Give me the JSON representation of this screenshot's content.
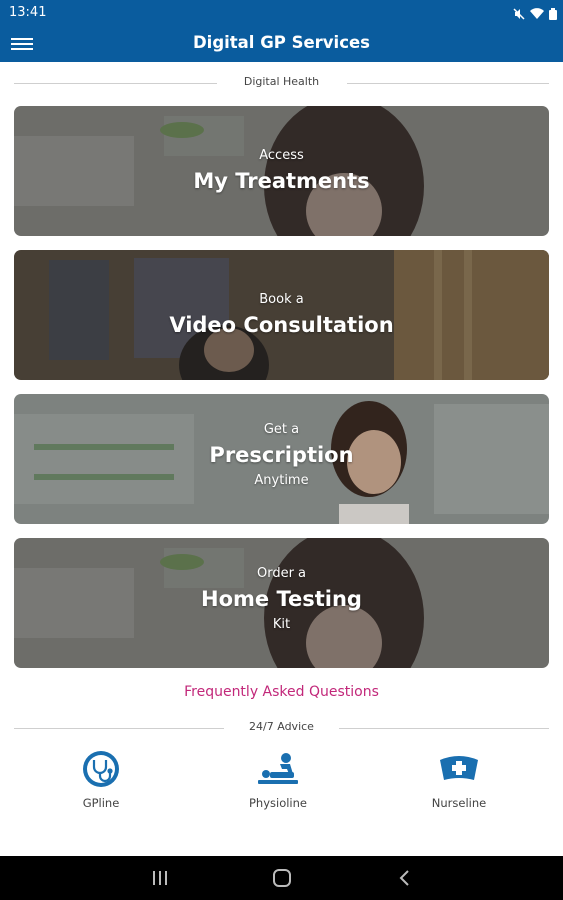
{
  "status_bar": {
    "time": "13:41"
  },
  "app_bar": {
    "title": "Digital GP Services"
  },
  "sections": {
    "digital_health": "Digital Health",
    "advice": "24/7 Advice"
  },
  "cards": [
    {
      "prefix": "Access",
      "title": "My Treatments",
      "suffix": ""
    },
    {
      "prefix": "Book a",
      "title": "Video Consultation",
      "suffix": ""
    },
    {
      "prefix": "Get a",
      "title": "Prescription",
      "suffix": "Anytime"
    },
    {
      "prefix": "Order a",
      "title": "Home Testing",
      "suffix": "Kit"
    }
  ],
  "faq": {
    "label": "Frequently Asked Questions"
  },
  "advice_items": [
    {
      "label": "GPline",
      "icon": "stethoscope-icon"
    },
    {
      "label": "Physioline",
      "icon": "physiotherapy-icon"
    },
    {
      "label": "Nurseline",
      "icon": "nurse-cap-icon"
    }
  ],
  "colors": {
    "primary": "#0a5c9e",
    "link": "#c2287a"
  }
}
